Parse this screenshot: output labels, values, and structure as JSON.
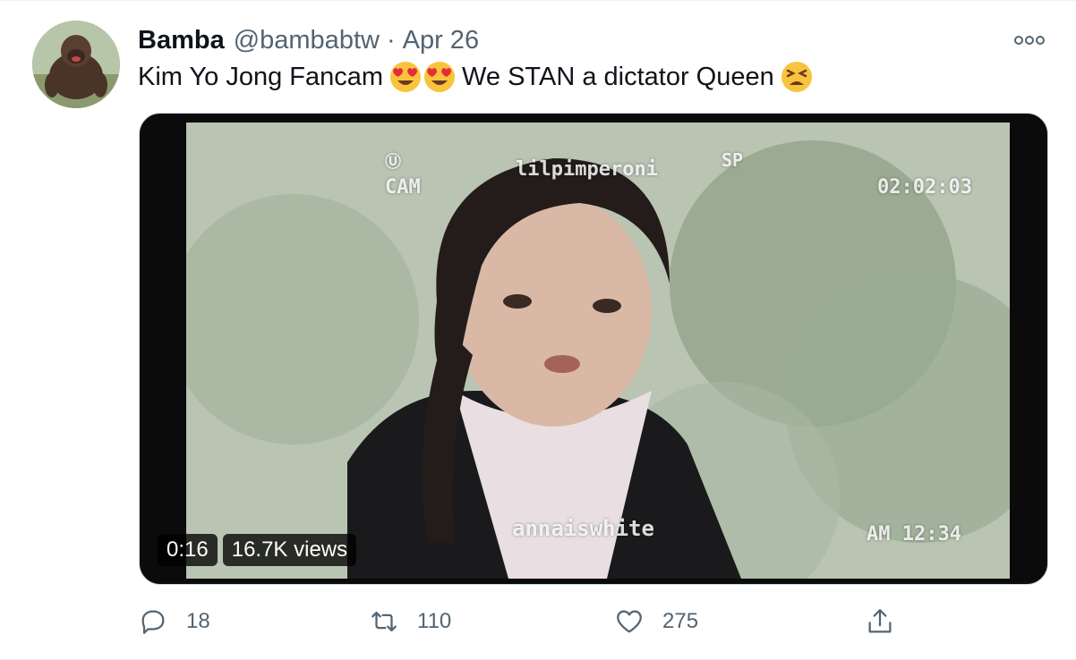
{
  "author": {
    "name": "Bamba",
    "handle": "@bambabtw",
    "separator": "·",
    "date": "Apr 26"
  },
  "tweet": {
    "text_part1": "Kim Yo Jong Fancam",
    "text_part2": "We STAN a dictator Queen",
    "emojis": [
      "heart-eyes-emoji",
      "heart-eyes-emoji",
      "tired-face-emoji"
    ]
  },
  "media": {
    "overlay_top_left_1": "Ⓤ",
    "overlay_cam": "CAM",
    "overlay_watermark_top": "lilpimperoni",
    "overlay_sp": "SP",
    "overlay_time_top": "02:02:03",
    "overlay_watermark_bottom": "annaiswhite",
    "overlay_time_bottom": "AM 12:34",
    "duration": "0:16",
    "views": "16.7K views"
  },
  "actions": {
    "reply_count": "18",
    "retweet_count": "110",
    "like_count": "275"
  },
  "colors": {
    "secondary_text": "#536471",
    "primary_text": "#0f1419",
    "border": "#cfd9de"
  }
}
